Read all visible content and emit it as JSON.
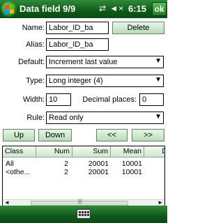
{
  "titlebar": {
    "title": "Data field 9/9",
    "status_icons": "⇄ ◄×",
    "clock": "6:15",
    "ok_label": "ok"
  },
  "form": {
    "name_label": "Name:",
    "name_value": "Labor_ID_ba",
    "delete_label": "Delete",
    "alias_label": "Alias:",
    "alias_value": "Labor_ID_ba",
    "default_label": "Default:",
    "default_value": "Increment last value",
    "type_label": "Type:",
    "type_value": "Long integer (4)",
    "width_label": "Width:",
    "width_value": "10",
    "decimal_label": "Decimal places:",
    "decimal_value": "0",
    "rule_label": "Rule:",
    "rule_value": "Read only"
  },
  "nav": {
    "up_label": "Up",
    "down_label": "Down",
    "prev_label": "<<",
    "next_label": ">>"
  },
  "table": {
    "headers": [
      "Class",
      "Num",
      "Sum",
      "Mean",
      "D"
    ],
    "rows": [
      [
        "All",
        "2",
        "20001",
        "10001"
      ],
      [
        "<othe...",
        "2",
        "20001",
        "10001"
      ]
    ]
  },
  "scroll_grip": "|||"
}
